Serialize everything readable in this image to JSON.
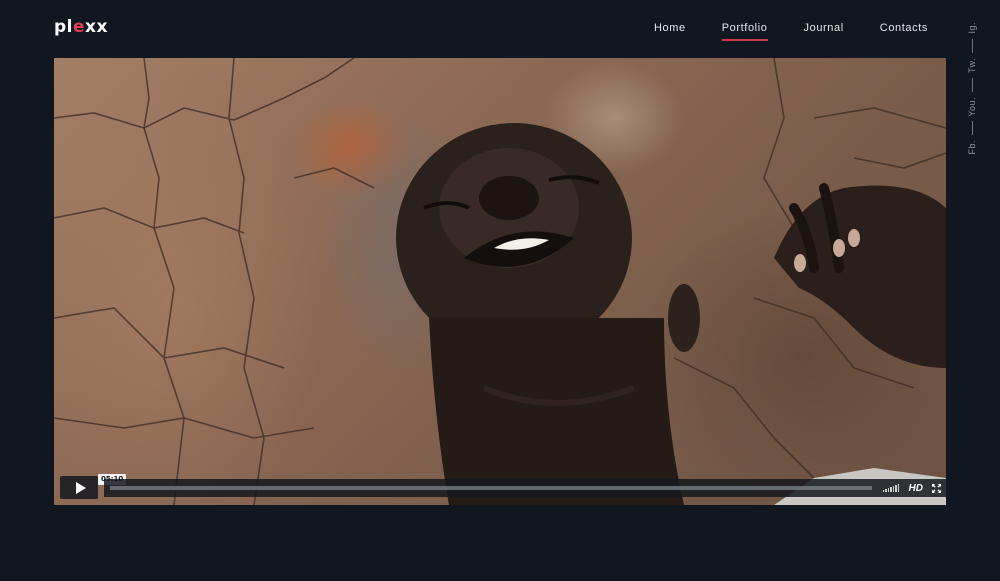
{
  "brand": {
    "logo_prefix": "pl",
    "logo_accent": "e",
    "logo_suffix": "xx"
  },
  "nav": {
    "items": [
      {
        "label": "Home",
        "active": false
      },
      {
        "label": "Portfolio",
        "active": true
      },
      {
        "label": "Journal",
        "active": false
      },
      {
        "label": "Contacts",
        "active": false
      }
    ]
  },
  "social": {
    "links": [
      "Ig.",
      "Tw.",
      "You.",
      "Fb."
    ]
  },
  "video": {
    "timestamp": "05:10",
    "progress": 0,
    "quality_label": "HD",
    "icons": [
      "play-icon",
      "volume-icon",
      "fullscreen-icon"
    ]
  },
  "colors": {
    "background": "#111720",
    "accent": "#d03a4a",
    "text": "#e6e6e6"
  }
}
